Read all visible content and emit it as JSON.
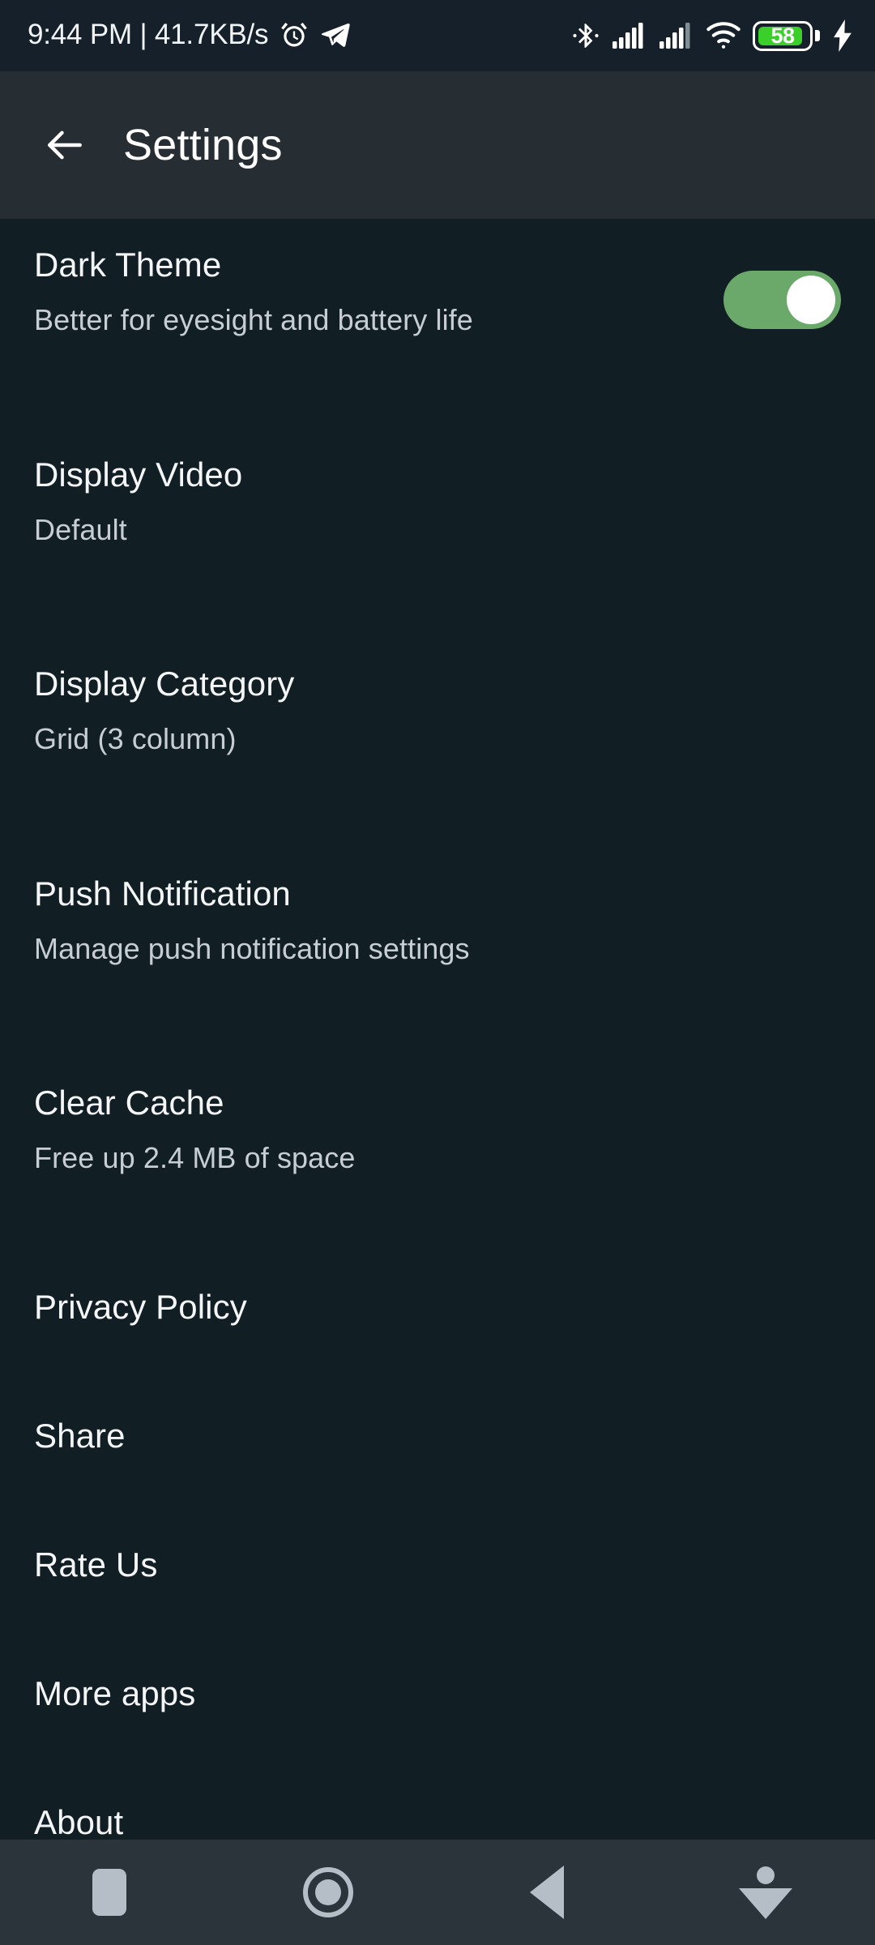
{
  "status_bar": {
    "clock_and_network": "9:44 PM | 41.7KB/s",
    "icons_left": [
      "alarm-icon",
      "telegram-icon"
    ],
    "icons_right": [
      "bluetooth-icon",
      "signal-sim1-icon",
      "signal-sim2-icon",
      "wifi-icon",
      "battery-icon",
      "charging-bolt-icon"
    ],
    "battery_percent": "58",
    "battery_fill_color": "#3bcf2a",
    "background": "#16202a"
  },
  "toolbar": {
    "back_icon": "arrow-left-icon",
    "title": "Settings",
    "background": "#262d33"
  },
  "settings": {
    "background": "#111e24",
    "items": [
      {
        "key": "dark-theme",
        "title": "Dark Theme",
        "subtitle": "Better for eyesight and battery life",
        "control": "toggle",
        "toggle_state": "on",
        "toggle_color": "#6aa96a",
        "thumb_color": "#ffffff"
      },
      {
        "key": "display-video",
        "title": "Display Video",
        "subtitle": "Default",
        "control": "none"
      },
      {
        "key": "display-category",
        "title": "Display Category",
        "subtitle": "Grid (3 column)",
        "control": "none"
      },
      {
        "key": "push-notification",
        "title": "Push Notification",
        "subtitle": "Manage push notification settings",
        "control": "none"
      },
      {
        "key": "clear-cache",
        "title": "Clear Cache",
        "subtitle": "Free up 2.4 MB of space",
        "control": "none"
      },
      {
        "key": "privacy-policy",
        "title": "Privacy Policy",
        "subtitle": "",
        "control": "none"
      },
      {
        "key": "share",
        "title": "Share",
        "subtitle": "",
        "control": "none"
      },
      {
        "key": "rate-us",
        "title": "Rate Us",
        "subtitle": "",
        "control": "none"
      },
      {
        "key": "more-apps",
        "title": "More apps",
        "subtitle": "",
        "control": "none"
      },
      {
        "key": "about",
        "title": "About",
        "subtitle": "",
        "control": "none"
      }
    ]
  },
  "navigation_bar": {
    "background": "#2b333b",
    "icon_color": "#b5bec7",
    "buttons": [
      {
        "key": "recents",
        "icon": "square-recents-icon"
      },
      {
        "key": "home",
        "icon": "circle-home-icon"
      },
      {
        "key": "back",
        "icon": "triangle-back-icon"
      },
      {
        "key": "collapse",
        "icon": "collapse-keyboard-icon"
      }
    ]
  }
}
